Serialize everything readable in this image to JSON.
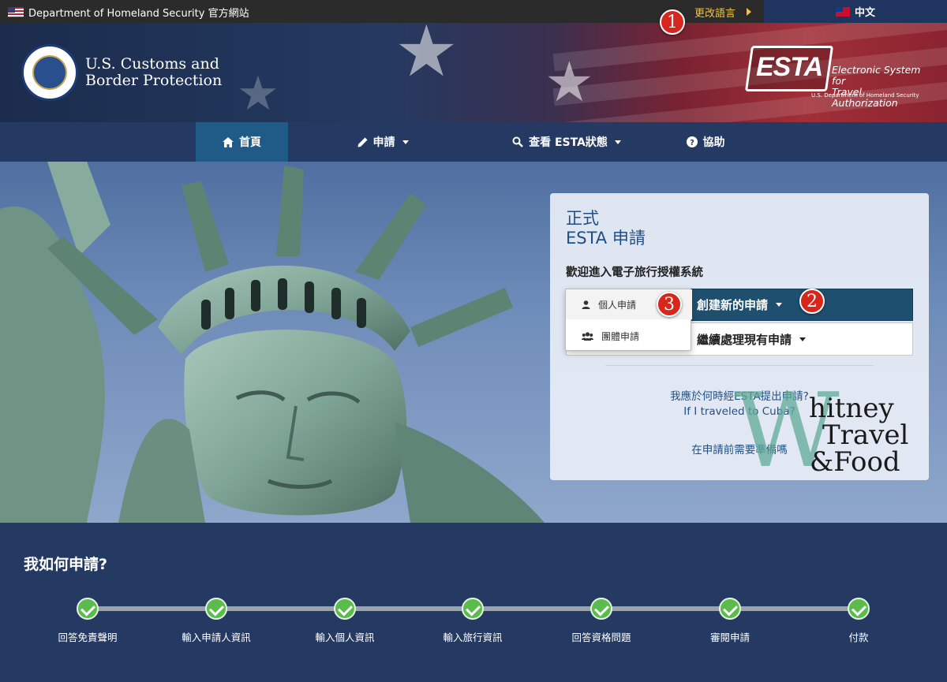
{
  "topbar": {
    "agency_label": "Department of Homeland Security 官方網站",
    "change_language": "更改語言",
    "current_language": "中文"
  },
  "header": {
    "agency_name": "U.S. Customs and",
    "agency_name_2": "Border Protection",
    "esta_word": "ESTA",
    "esta_desc_1": "Electronic System for",
    "esta_desc_2": "Travel Authorization",
    "esta_sub": "U.S. Department of Homeland Security"
  },
  "nav": {
    "items": [
      {
        "label": "首頁",
        "icon": "home-icon",
        "active": true
      },
      {
        "label": "申請",
        "icon": "pencil-icon"
      },
      {
        "label": "查看 ESTA狀態",
        "icon": "search-icon"
      },
      {
        "label": "協助",
        "icon": "help-icon"
      }
    ]
  },
  "panel": {
    "title_1": "正式",
    "title_2": "ESTA 申請",
    "welcome": "歡迎進入電子旅行授權系統",
    "create_btn": "創建新的申請",
    "continue_btn": "繼續處理現有申請",
    "links": [
      "我應於何時經ESTA提出申請?",
      "If I traveled to Cuba?",
      "在申請前需要準備嗎"
    ]
  },
  "dropdown": {
    "items": [
      {
        "label": "個人申請",
        "icon": "user-icon"
      },
      {
        "label": "團體申請",
        "icon": "users-icon"
      }
    ]
  },
  "annotations": [
    "1",
    "2",
    "3"
  ],
  "watermark": {
    "w": "W",
    "line1": "hitney",
    "line2": "Travel",
    "line3": "&Food"
  },
  "steps": {
    "title": "我如何申請?",
    "items": [
      "回答免責聲明",
      "輸入申請人資訊",
      "輸入個人資訊",
      "輸入旅行資訊",
      "回答資格問題",
      "審閱申請",
      "付款"
    ]
  },
  "colors": {
    "nav": "#253a62",
    "active_nav": "#1f5b86",
    "check": "#5bbb4c",
    "badge": "#d7261b",
    "link": "#1f4f86"
  }
}
